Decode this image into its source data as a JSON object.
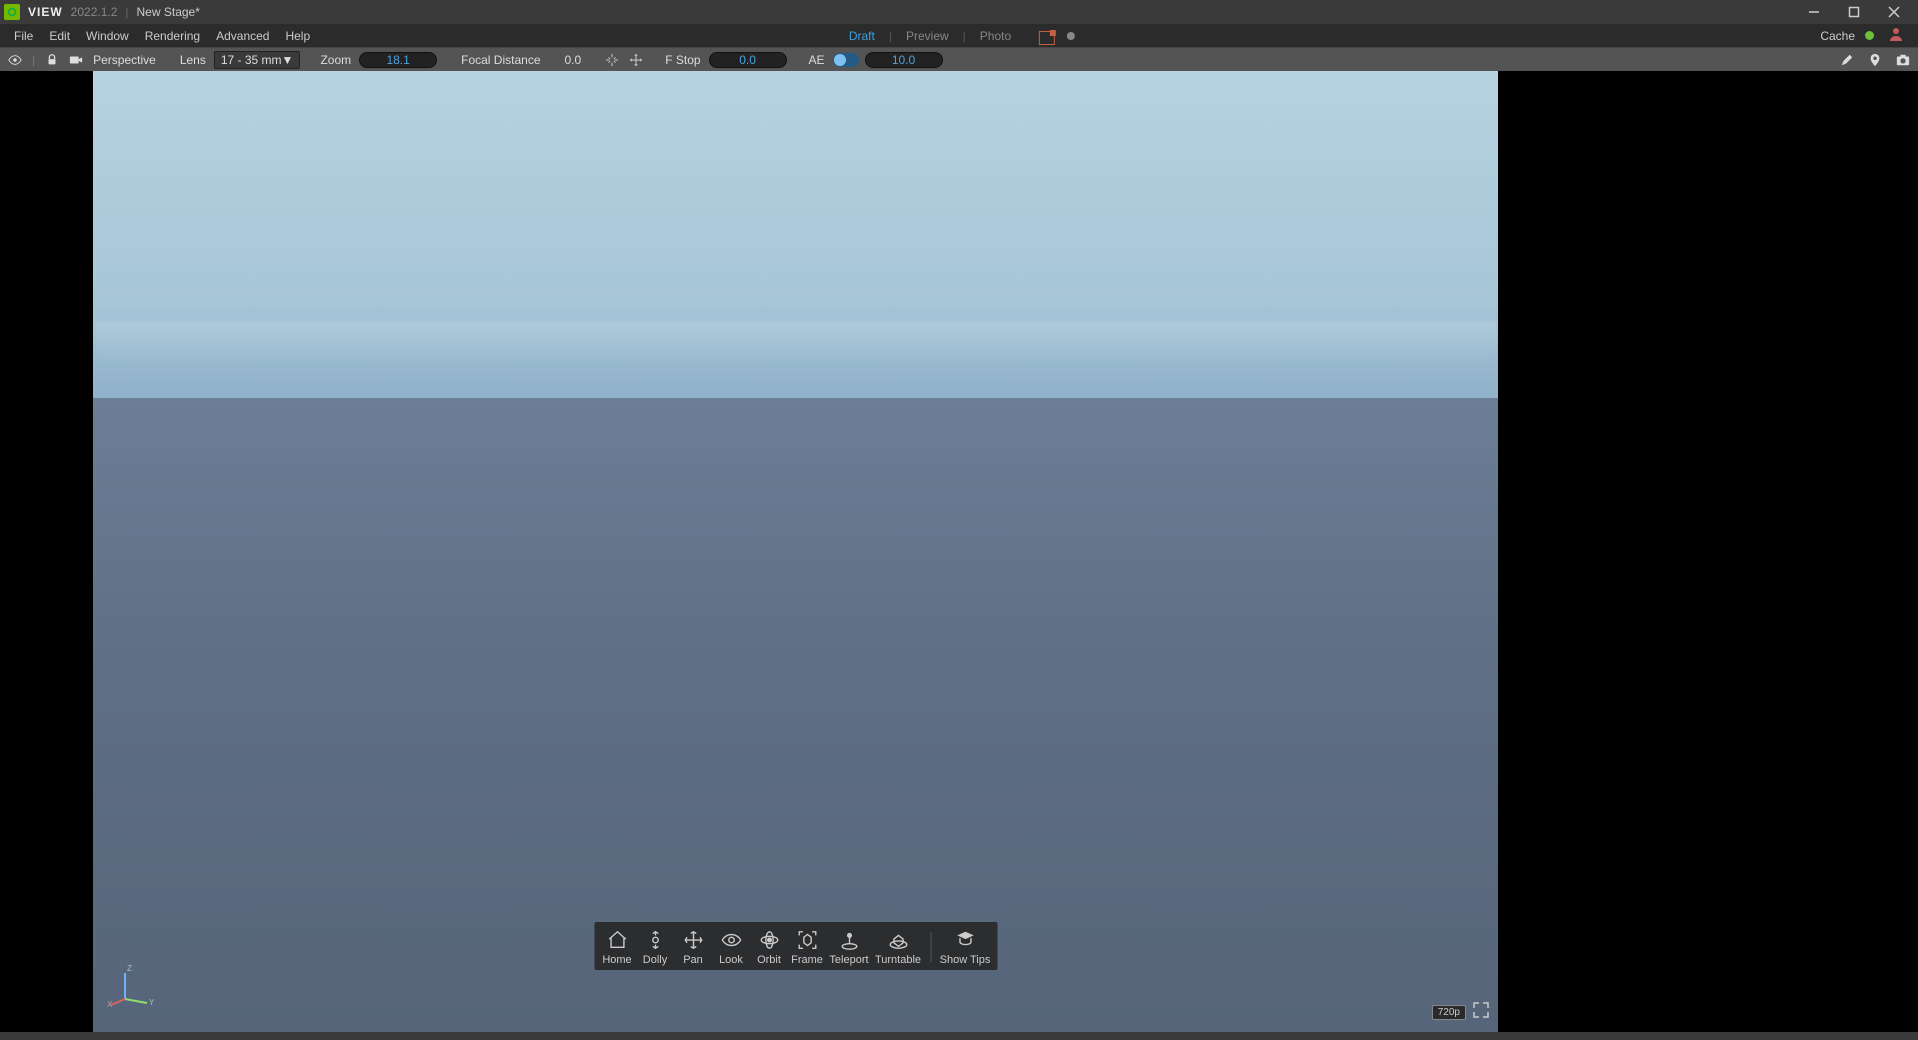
{
  "title_bar": {
    "app_name": "VIEW",
    "version": "2022.1.2",
    "stage_name": "New Stage*"
  },
  "menu": {
    "items": [
      "File",
      "Edit",
      "Window",
      "Rendering",
      "Advanced",
      "Help"
    ],
    "modes": {
      "draft": "Draft",
      "preview": "Preview",
      "photo": "Photo"
    },
    "cache_label": "Cache"
  },
  "viewport_toolbar": {
    "camera_label": "Perspective",
    "lens_label": "Lens",
    "lens_value": "17 - 35 mm",
    "zoom_label": "Zoom",
    "zoom_value": "18.1",
    "focal_label": "Focal Distance",
    "focal_value": "0.0",
    "fstop_label": "F Stop",
    "fstop_value": "0.0",
    "ae_label": "AE",
    "ae_value": "10.0"
  },
  "navbar": {
    "items": [
      "Home",
      "Dolly",
      "Pan",
      "Look",
      "Orbit",
      "Frame",
      "Teleport",
      "Turntable",
      "Show Tips"
    ]
  },
  "axis": {
    "x": "X",
    "y": "Y",
    "z": "Z"
  },
  "overlay": {
    "resolution": "720p"
  },
  "colors": {
    "selection_outline": "#e8982f",
    "accent_blue": "#3ea0da",
    "nvidia_green": "#76b900"
  }
}
